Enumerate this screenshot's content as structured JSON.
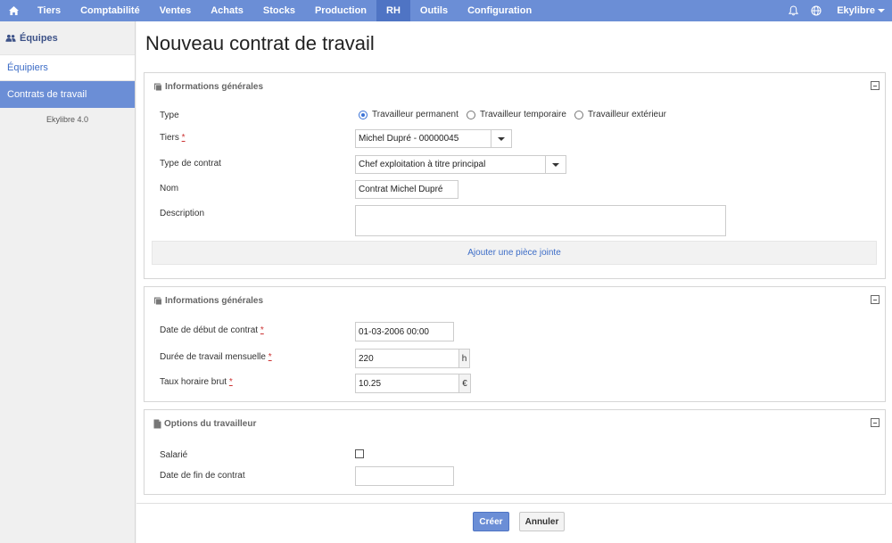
{
  "nav": {
    "items": [
      {
        "label": "Tiers",
        "active": false
      },
      {
        "label": "Comptabilité",
        "active": false
      },
      {
        "label": "Ventes",
        "active": false
      },
      {
        "label": "Achats",
        "active": false
      },
      {
        "label": "Stocks",
        "active": false
      },
      {
        "label": "Production",
        "active": false
      },
      {
        "label": "RH",
        "active": true
      },
      {
        "label": "Outils",
        "active": false
      },
      {
        "label": "Configuration",
        "active": false
      }
    ],
    "user": "Ekylibre"
  },
  "sidebar": {
    "title": "Équipes",
    "items": [
      {
        "label": "Équipiers"
      },
      {
        "label": "Contrats de travail"
      }
    ],
    "version": "Ekylibre 4.0"
  },
  "page": {
    "title": "Nouveau contrat de travail"
  },
  "panel1": {
    "title": "Informations générales",
    "type_label": "Type",
    "type_options": [
      "Travailleur permanent",
      "Travailleur temporaire",
      "Travailleur extérieur"
    ],
    "type_selected": "Travailleur permanent",
    "tiers_label": "Tiers",
    "tiers_value": "Michel Dupré - 00000045",
    "contract_type_label": "Type de contrat",
    "contract_type_value": "Chef exploitation à titre principal",
    "name_label": "Nom",
    "name_value": "Contrat Michel Dupré",
    "description_label": "Description",
    "description_value": "",
    "attach_label": "Ajouter une pièce jointe"
  },
  "panel2": {
    "title": "Informations générales",
    "start_label": "Date de début de contrat",
    "start_value": "01-03-2006 00:00",
    "duration_label": "Durée de travail mensuelle",
    "duration_value": "220",
    "duration_unit": "h",
    "rate_label": "Taux horaire brut",
    "rate_value": "10.25",
    "rate_unit": "€"
  },
  "panel3": {
    "title": "Options du travailleur",
    "salaried_label": "Salarié",
    "salaried_checked": false,
    "end_label": "Date de fin de contrat",
    "end_value": ""
  },
  "actions": {
    "create": "Créer",
    "cancel": "Annuler"
  },
  "required_marker": "*",
  "colors": {
    "nav_bg": "#6b8ed6",
    "nav_active": "#4f74c4",
    "link": "#3d6dc7",
    "radio_checked": "#3b73d6"
  }
}
